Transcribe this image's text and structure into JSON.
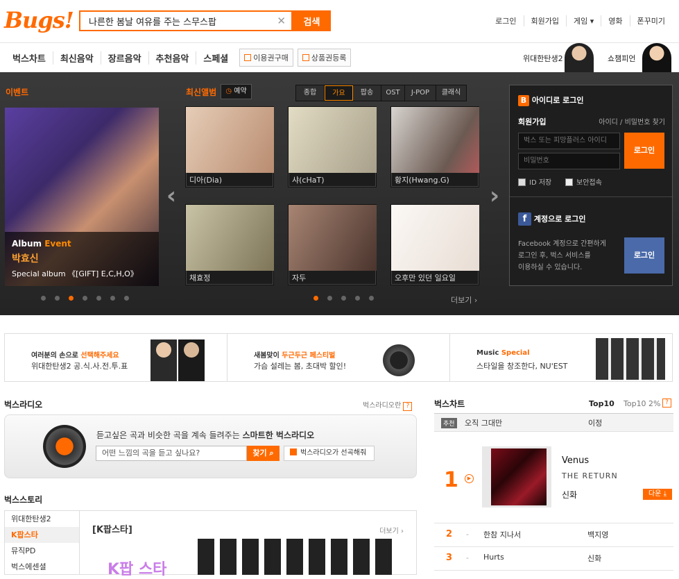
{
  "header": {
    "logo": "Bugs!",
    "search_value": "나른한 봄날 여유를 주는 스무스팝",
    "search_button": "검색",
    "util_links": [
      "로그인",
      "회원가입",
      "게임 ▾",
      "영화",
      "폰꾸미기"
    ]
  },
  "nav": {
    "items": [
      "벅스차트",
      "최신음악",
      "장르음악",
      "추천음악",
      "스페셜"
    ],
    "buttons": [
      "이용권구매",
      "상품권등록"
    ],
    "promo": [
      "위대한탄생2",
      "쇼챔피언"
    ]
  },
  "event": {
    "label": "이벤트",
    "caption_prefix": "Album",
    "caption_highlight": "Event",
    "artist": "박효신",
    "subtitle": "Special album 《[GIFT] E,C,H,O》",
    "active_dot": 2
  },
  "latest": {
    "label": "최신앨범",
    "reserve": "예약",
    "tabs": [
      "종합",
      "가요",
      "팝송",
      "OST",
      "J-POP",
      "클래식"
    ],
    "active_tab": 1,
    "albums": [
      {
        "name": "디아(Dia)",
        "color": "#d8b49a"
      },
      {
        "name": "샤(cHaT)",
        "color": "#c9c1a8"
      },
      {
        "name": "황지(Hwang.G)",
        "color": "#8c7a6e"
      },
      {
        "name": "채효정",
        "color": "#b7a88b"
      },
      {
        "name": "자두",
        "color": "#8b6a5c"
      },
      {
        "name": "오후만 있던 일요일",
        "color": "#f4efea"
      }
    ],
    "more": "더보기 ›",
    "active_dot": 0
  },
  "login": {
    "id_login": "아이디로 로그인",
    "signup": "회원가입",
    "find": "아이디 / 비밀번호 찾기",
    "id_placeholder": "벅스 또는 피망플러스 아이디",
    "pw_placeholder": "비밀번호",
    "login_button": "로그인",
    "save_id": "ID 저장",
    "secure": "보안접속",
    "account_login": "계정으로 로그인",
    "fb_text": [
      "Facebook 계정으로 간편하게",
      "로그인 후, 벅스 서비스를",
      "이용하실 수 있습니다."
    ],
    "fb_button": "로그인"
  },
  "banners": [
    {
      "line1_pre": "여러분의 손으로 ",
      "line1_hl": "선택해주세요",
      "line2": "위대한탄생2 공.식.사.전.투.표"
    },
    {
      "line1_pre": "새봄맞이 ",
      "line1_hl": "두근두근 페스티벌",
      "line2": "가슴 설레는 봄, 초대박 할인!"
    },
    {
      "line1_pre": "Music ",
      "line1_hl": "Special",
      "line2": "스타일을 창조한다, NU'EST"
    }
  ],
  "radio": {
    "title": "벅스라디오",
    "link": "벅스라디오란",
    "desc_pre": "듣고싶은 곡과 비슷한 곡을 계속 들려주는 ",
    "desc_bold": "스마트한 벅스라디오",
    "input_placeholder": "어떤 느낌의 곡을 듣고 싶나요?",
    "find_button": "찾기",
    "pick_button": "벅스라디오가 선곡해줘"
  },
  "story": {
    "title": "벅스스토리",
    "menu": [
      "위대한탄생2",
      "K팝스타",
      "뮤직PD",
      "벅스에센셜"
    ],
    "active": 1,
    "heading": "[K팝스타]",
    "more": "더보기 ›",
    "banner_text": "K팝 스타"
  },
  "chart": {
    "title": "벅스차트",
    "tab_top10": "Top10",
    "tab_top10_2": "Top10 2%",
    "recommend_badge": "추천",
    "recommend_song": "오직 그대만",
    "recommend_artist": "이정",
    "first": {
      "rank": "1",
      "song": "Venus",
      "album": "THE RETURN",
      "artist": "신화",
      "download": "다운"
    },
    "rows": [
      {
        "rank": "2",
        "change": "-",
        "song": "한참 지나서",
        "artist": "백지영"
      },
      {
        "rank": "3",
        "change": "-",
        "song": "Hurts",
        "artist": "신화"
      }
    ]
  }
}
